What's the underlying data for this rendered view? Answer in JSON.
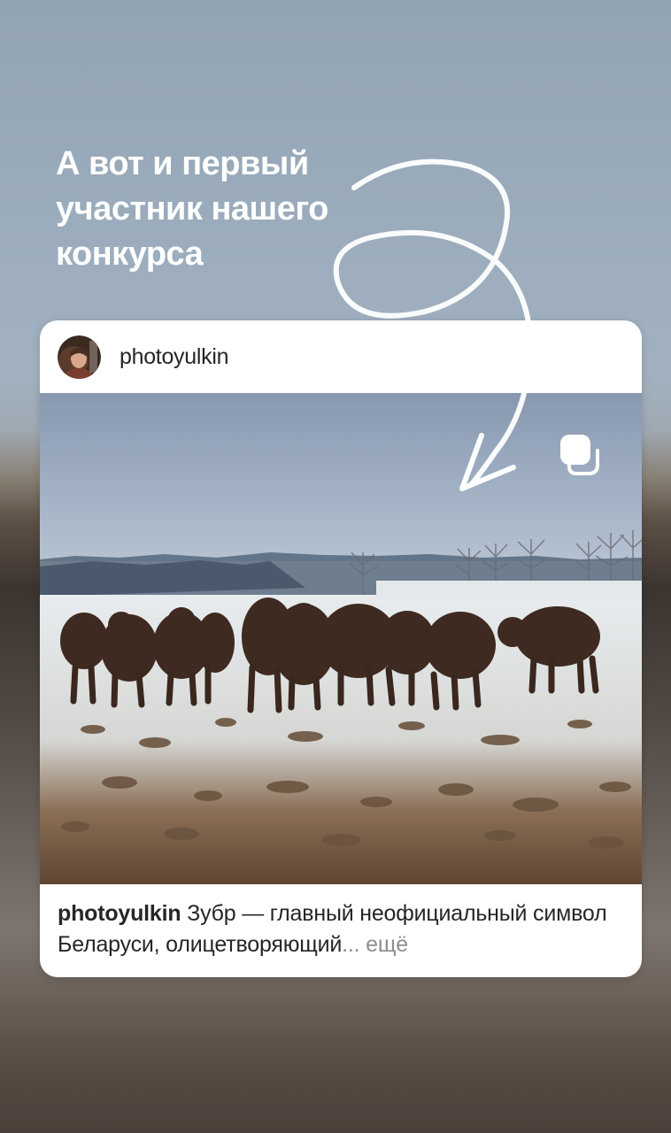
{
  "story": {
    "text": "А вот и первый\nучастник нашего\nконкурса"
  },
  "post": {
    "username": "photoyulkin",
    "caption": {
      "username": "photoyulkin",
      "text": "Зубр — главный неофициальный символ Беларуси, олицетворяющий",
      "ellipsis": "...",
      "more_label": "ещё"
    },
    "icons": {
      "avatar": "profile-avatar",
      "multi_post": "carousel-icon"
    }
  },
  "colors": {
    "text_primary": "#262626",
    "text_secondary": "#8e8e8e",
    "card_background": "#ffffff"
  }
}
